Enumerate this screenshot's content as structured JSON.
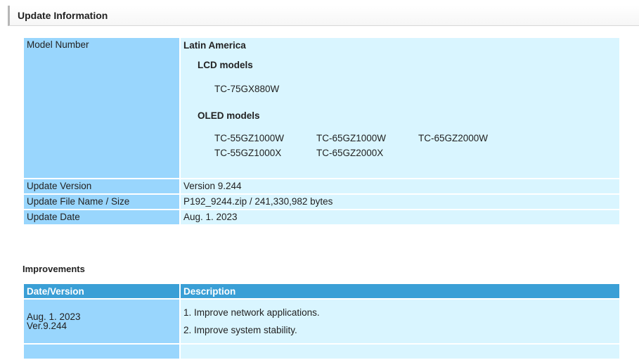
{
  "header": {
    "title": "Update Information"
  },
  "info": {
    "model_number_label": "Model Number",
    "region": "Latin America",
    "lcd_title": "LCD models",
    "lcd_models": [
      "TC-75GX880W"
    ],
    "oled_title": "OLED models",
    "oled_models": [
      "TC-55GZ1000W",
      "TC-65GZ1000W",
      "TC-65GZ2000W",
      "TC-55GZ1000X",
      "TC-65GZ2000X"
    ],
    "version_label": "Update Version",
    "version_value": "Version 9.244",
    "file_label": "Update File Name / Size",
    "file_value": "P192_9244.zip / 241,330,982 bytes",
    "date_label": "Update Date",
    "date_value": "Aug. 1. 2023"
  },
  "improvements": {
    "title": "Improvements",
    "col_date": "Date/Version",
    "col_desc": "Description",
    "rows": [
      {
        "date": "Aug. 1. 2023",
        "version": "Ver.9.244",
        "items": [
          "1. Improve network applications.",
          "2. Improve system stability."
        ]
      }
    ]
  }
}
